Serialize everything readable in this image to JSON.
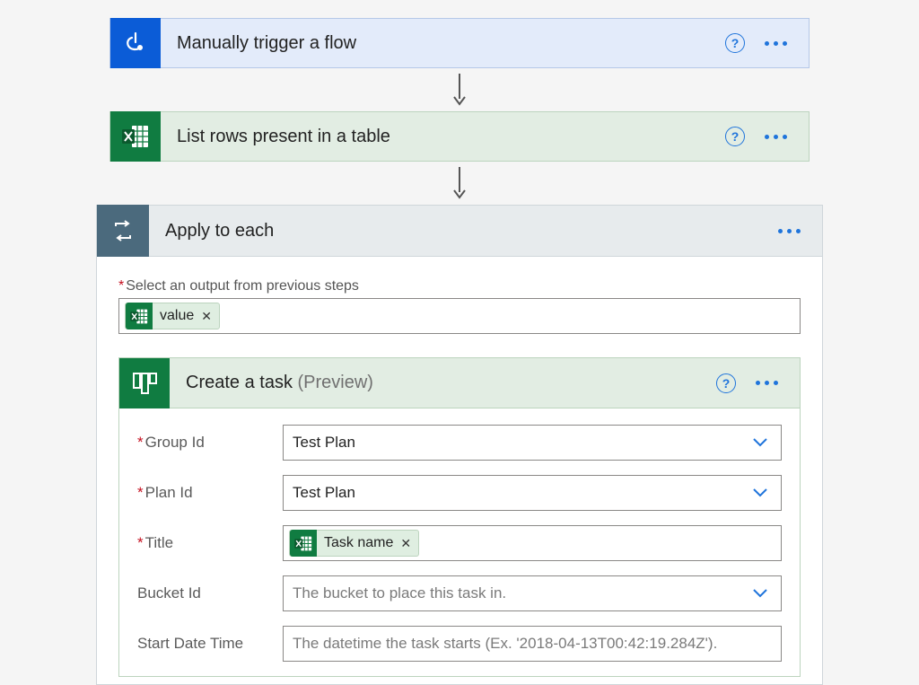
{
  "flow": {
    "trigger": {
      "title": "Manually trigger a flow"
    },
    "excel": {
      "title": "List rows present in a table"
    },
    "apply": {
      "title": "Apply to each",
      "select_label": "Select an output from previous steps",
      "token": "value"
    },
    "planner": {
      "title": "Create a task",
      "suffix": "(Preview)",
      "fields": {
        "group_id": {
          "label": "Group Id",
          "value": "Test Plan",
          "required": true,
          "dropdown": true
        },
        "plan_id": {
          "label": "Plan Id",
          "value": "Test Plan",
          "required": true,
          "dropdown": true
        },
        "title": {
          "label": "Title",
          "token": "Task name",
          "required": true
        },
        "bucket_id": {
          "label": "Bucket Id",
          "placeholder": "The bucket to place this task in.",
          "dropdown": true
        },
        "start_date": {
          "label": "Start Date Time",
          "placeholder": "The datetime the task starts (Ex. '2018-04-13T00:42:19.284Z')."
        }
      }
    }
  }
}
